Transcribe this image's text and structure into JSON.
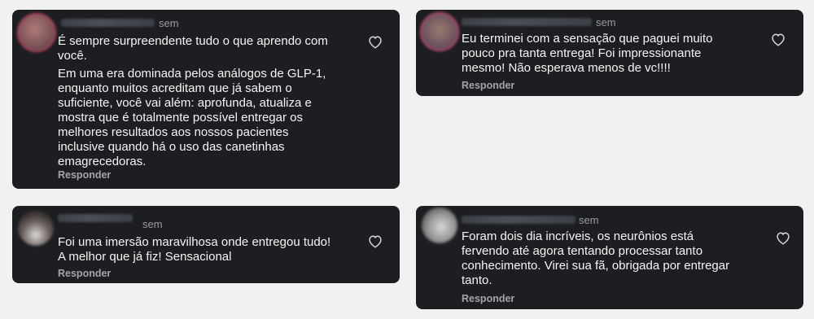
{
  "comments": [
    {
      "time": "sem",
      "paragraphs": [
        "É sempre surpreendente tudo o que aprendo com\nvocê.",
        "Em uma era dominada pelos análogos de GLP-1,\nenquanto muitos acreditam que já sabem o\nsuficiente, você vai além: aprofunda, atualiza e\nmostra que é totalmente possível entregar os\nmelhores resultados aos nossos pacientes\ninclusive quando há o uso das canetinhas\nemagrecedoras."
      ],
      "reply": "Responder"
    },
    {
      "time": "sem",
      "paragraphs": [
        "Eu terminei com a sensação que paguei muito\npouco pra tanta entrega! Foi impressionante\nmesmo! Não esperava menos de vc!!!!"
      ],
      "reply": "Responder"
    },
    {
      "time": "sem",
      "paragraphs": [
        "Foi uma imersão maravilhosa onde entregou tudo!\nA melhor que já fiz! Sensacional"
      ],
      "reply": "Responder"
    },
    {
      "time": "sem",
      "paragraphs": [
        "Foram dois dia incríveis, os neurônios está\nfervendo até agora tentando processar tanto\nconhecimento. Virei sua fã, obrigada por entregar\ntanto."
      ],
      "reply": "Responder"
    }
  ],
  "icons": {
    "like": "heart-outline-icon",
    "avatar": "blurred-avatar"
  },
  "colors": {
    "card_background": "#1c1e22",
    "page_background": "#f1f1f1",
    "text": "#f5f5f5",
    "muted": "#a3a5ab"
  }
}
